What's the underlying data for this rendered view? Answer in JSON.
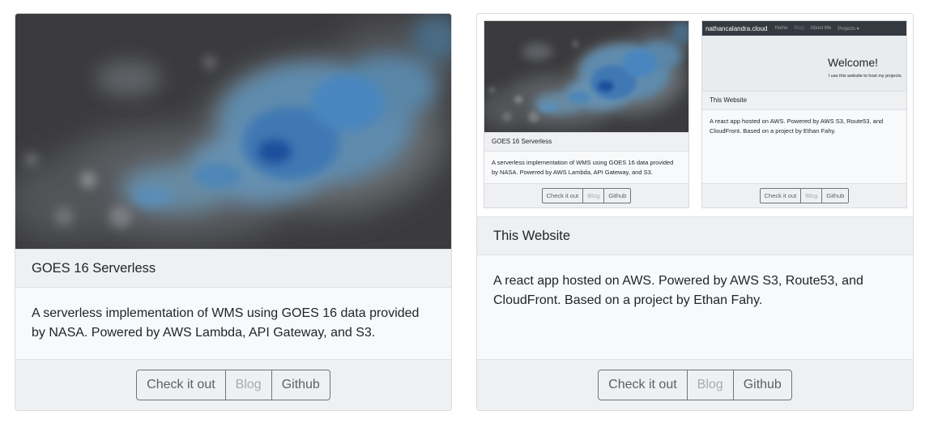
{
  "cards": [
    {
      "title": "GOES 16 Serverless",
      "description": "A serverless implementation of WMS using GOES 16 data provided by NASA. Powered by AWS Lambda, API Gateway, and S3.",
      "buttons": {
        "check": "Check it out",
        "blog": "Blog",
        "github": "Github"
      }
    },
    {
      "title": "This Website",
      "description": "A react app hosted on AWS. Powered by AWS S3, Route53, and CloudFront. Based on a project by Ethan Fahy.",
      "buttons": {
        "check": "Check it out",
        "blog": "Blog",
        "github": "Github"
      },
      "preview": {
        "left": {
          "title": "GOES 16 Serverless",
          "description": "A serverless implementation of WMS using GOES 16 data provided by NASA. Powered by AWS Lambda, API Gateway, and S3.",
          "buttons": {
            "check": "Check it out",
            "blog": "Blog",
            "github": "Github"
          }
        },
        "right": {
          "nav": {
            "brand": "nathancalandra.cloud",
            "home": "Home",
            "blog": "Blog",
            "about": "About Me",
            "projects": "Projects ▾"
          },
          "welcome": "Welcome!",
          "tagline": "I use this website to host my projects.",
          "title": "This Website",
          "description": "A react app hosted on AWS. Powered by AWS S3, Route53, and CloudFront. Based on a project by Ethan Fahy.",
          "buttons": {
            "check": "Check it out",
            "blog": "Blog",
            "github": "Github"
          }
        }
      }
    }
  ],
  "colors": {
    "cloud_dark": "#3a3a3c",
    "cloud_blue": "#4b8fc4",
    "cloud_deep": "#1d4f9a",
    "button_border": "#6c757d"
  }
}
